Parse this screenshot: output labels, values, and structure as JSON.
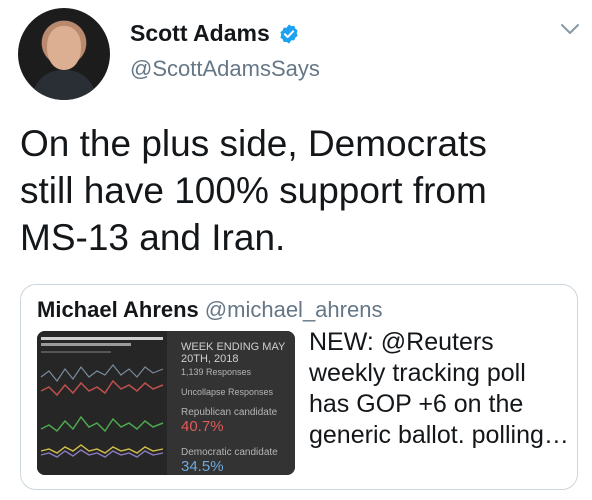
{
  "author": {
    "display_name": "Scott Adams",
    "handle": "@ScottAdamsSays"
  },
  "tweet": {
    "text": "On the plus side, Democrats still have 100% support from MS-13 and Iran."
  },
  "quoted_tweet": {
    "display_name": "Michael Ahrens",
    "handle": "@michael_ahrens",
    "text": "NEW: @Reuters weekly tracking poll has GOP +6 on the generic ballot. polling…",
    "media": {
      "week_label": "WEEK ENDING MAY 20TH, 2018",
      "responses": "1,139 Responses",
      "uncollapse": "Uncollapse Responses",
      "republican_label": "Republican candidate",
      "republican_value": "40.7%",
      "democratic_label": "Democratic candidate",
      "democratic_value": "34.5%"
    }
  },
  "colors": {
    "verified_blue": "#1da1f2",
    "republican_red": "#e05a5a",
    "democratic_blue": "#6fa8dc"
  }
}
